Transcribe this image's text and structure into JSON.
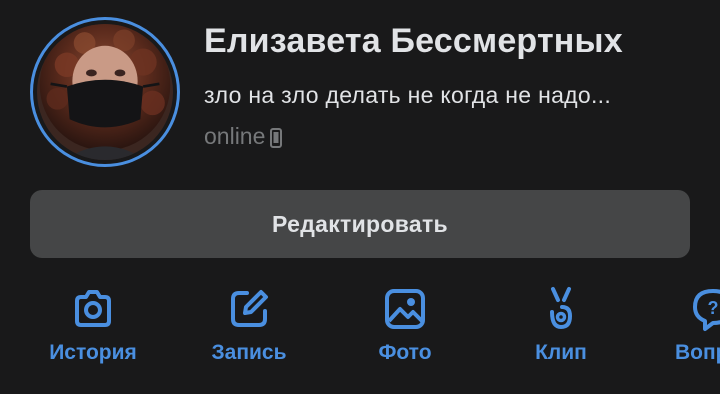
{
  "profile": {
    "name": "Елизавета Бессмертных",
    "status": "зло на зло делать не когда не надо...",
    "presence": "online",
    "presence_icon": "phone-icon"
  },
  "edit_button": {
    "label": "Редактировать"
  },
  "actions": [
    {
      "label": "История",
      "icon": "camera-icon"
    },
    {
      "label": "Запись",
      "icon": "edit-icon"
    },
    {
      "label": "Фото",
      "icon": "photo-icon"
    },
    {
      "label": "Клип",
      "icon": "clip-icon"
    },
    {
      "label": "Вопр",
      "icon": "question-icon"
    }
  ],
  "colors": {
    "background": "#19191a",
    "accent": "#4a8fe0",
    "text": "#e1e3e6",
    "muted": "#76787a",
    "button": "#454647"
  }
}
